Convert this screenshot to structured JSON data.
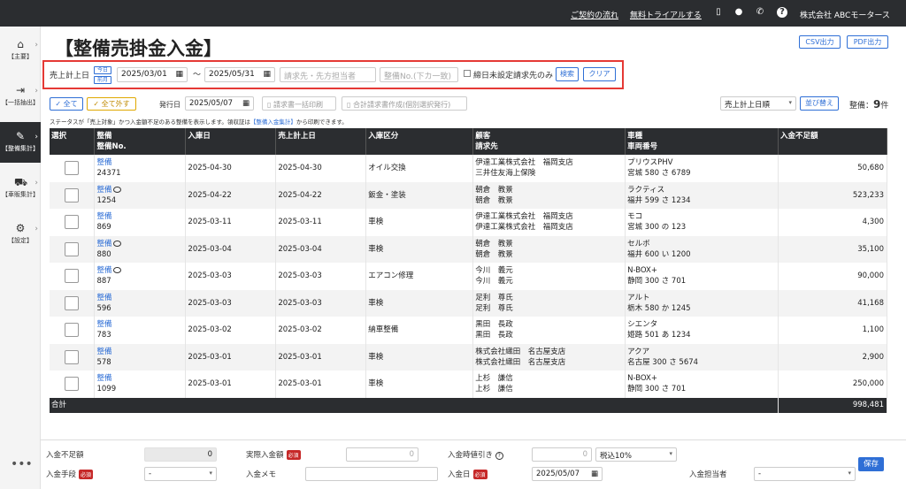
{
  "topbar": {
    "contract_flow": "ご契約の流れ",
    "free_trial": "無料トライアルする",
    "company": "株式会社 ABCモータース"
  },
  "sidebar": {
    "items": [
      {
        "label": "【主要】",
        "icon": "home-icon"
      },
      {
        "label": "【一括抽出】",
        "icon": "export-icon"
      },
      {
        "label": "【整備集計】",
        "icon": "wrench-icon"
      },
      {
        "label": "【車販集計】",
        "icon": "car-icon"
      },
      {
        "label": "【設定】",
        "icon": "gear-icon"
      }
    ],
    "more": "•••"
  },
  "page": {
    "title": "【整備売掛金入金】",
    "csv": "CSV出力",
    "pdf": "PDF出力"
  },
  "filter": {
    "date_label": "売上計上日",
    "this_month": "今日",
    "prev_month": "前月",
    "from": "2025/03/01",
    "tilde": "〜",
    "to": "2025/05/31",
    "billing_ph": "請求先・先方担当者",
    "no_ph": "整備No.(下カ一致)",
    "closing_label": "締日未設定請求先のみ",
    "search": "検索",
    "clear": "クリア"
  },
  "actions": {
    "select_all": "✓ 全て",
    "deselect_all": "✓ 全て外す",
    "issue_label": "発行日",
    "issue_date": "2025/05/07",
    "bulk_print": "請求書一括印刷",
    "combined": "合計請求書作成(個別選択発行)",
    "sort": "売上計上日順",
    "reorder": "並び替え",
    "count_label": "整備：",
    "count_value": "9",
    "count_unit": "件",
    "note_pre": "ステータスが「売上対象」かつ入金額不足のある整備を表示します。領収証は",
    "note_link": "【整備入金集計】",
    "note_post": "から印刷できます。"
  },
  "table": {
    "headers": [
      {
        "l1": "選択",
        "l2": ""
      },
      {
        "l1": "整備",
        "l2": "整備No."
      },
      {
        "l1": "入庫日",
        "l2": ""
      },
      {
        "l1": "売上計上日",
        "l2": ""
      },
      {
        "l1": "入庫区分",
        "l2": ""
      },
      {
        "l1": "顧客",
        "l2": "請求先"
      },
      {
        "l1": "車種",
        "l2": "車両番号"
      },
      {
        "l1": "入金不足額",
        "l2": ""
      }
    ],
    "rows": [
      {
        "type": "整備",
        "memo": false,
        "no": "24371",
        "in": "2025-04-30",
        "sale": "2025-04-30",
        "kind": "オイル交換",
        "cust": "伊達工業株式会社　福岡支店",
        "bill": "三井住友海上保険",
        "car": "プリウスPHV",
        "plate": "宮城 580 さ 6789",
        "amount": "50,680"
      },
      {
        "type": "整備",
        "memo": true,
        "no": "1254",
        "in": "2025-04-22",
        "sale": "2025-04-22",
        "kind": "鈑金・塗装",
        "cust": "朝倉　教景",
        "bill": "朝倉　教景",
        "car": "ラクティス",
        "plate": "福井 599 さ 1234",
        "amount": "523,233"
      },
      {
        "type": "整備",
        "memo": false,
        "no": "869",
        "in": "2025-03-11",
        "sale": "2025-03-11",
        "kind": "車検",
        "cust": "伊達工業株式会社　福岡支店",
        "bill": "伊達工業株式会社　福岡支店",
        "car": "モコ",
        "plate": "宮城 300 の 123",
        "amount": "4,300"
      },
      {
        "type": "整備",
        "memo": true,
        "no": "880",
        "in": "2025-03-04",
        "sale": "2025-03-04",
        "kind": "車検",
        "cust": "朝倉　教景",
        "bill": "朝倉　教景",
        "car": "セルボ",
        "plate": "福井 600 い 1200",
        "amount": "35,100"
      },
      {
        "type": "整備",
        "memo": true,
        "no": "887",
        "in": "2025-03-03",
        "sale": "2025-03-03",
        "kind": "エアコン修理",
        "cust": "今川　義元",
        "bill": "今川　義元",
        "car": "N-BOX+",
        "plate": "静岡 300 さ 701",
        "amount": "90,000"
      },
      {
        "type": "整備",
        "memo": false,
        "no": "596",
        "in": "2025-03-03",
        "sale": "2025-03-03",
        "kind": "車検",
        "cust": "足利　尊氏",
        "bill": "足利　尊氏",
        "car": "アルト",
        "plate": "栃木 580 か 1245",
        "amount": "41,168"
      },
      {
        "type": "整備",
        "memo": false,
        "no": "783",
        "in": "2025-03-02",
        "sale": "2025-03-02",
        "kind": "納車整備",
        "cust": "黒田　長政",
        "bill": "黒田　長政",
        "car": "シエンタ",
        "plate": "姫路 501 あ 1234",
        "amount": "1,100"
      },
      {
        "type": "整備",
        "memo": false,
        "no": "578",
        "in": "2025-03-01",
        "sale": "2025-03-01",
        "kind": "車検",
        "cust": "株式会社織田　名古屋支店",
        "bill": "株式会社織田　名古屋支店",
        "car": "アクア",
        "plate": "名古屋 300 さ 5674",
        "amount": "2,900"
      },
      {
        "type": "整備",
        "memo": false,
        "no": "1099",
        "in": "2025-03-01",
        "sale": "2025-03-01",
        "kind": "車検",
        "cust": "上杉　謙信",
        "bill": "上杉　謙信",
        "car": "N-BOX+",
        "plate": "静岡 300 さ 701",
        "amount": "250,000"
      }
    ],
    "total_label": "合計",
    "total_value": "998,481"
  },
  "footer": {
    "shortage_label": "入金不足額",
    "shortage_value": "0",
    "actual_label": "実際入金額",
    "actual_ph": "0",
    "discount_label": "入金時値引き",
    "discount_ph": "0",
    "tax": "税込10%",
    "method_label": "入金手段",
    "method_value": "-",
    "memo_label": "入金メモ",
    "date_label": "入金日",
    "date_value": "2025/05/07",
    "staff_label": "入金担当者",
    "staff_value": "-",
    "required": "必須",
    "save": "保存"
  }
}
